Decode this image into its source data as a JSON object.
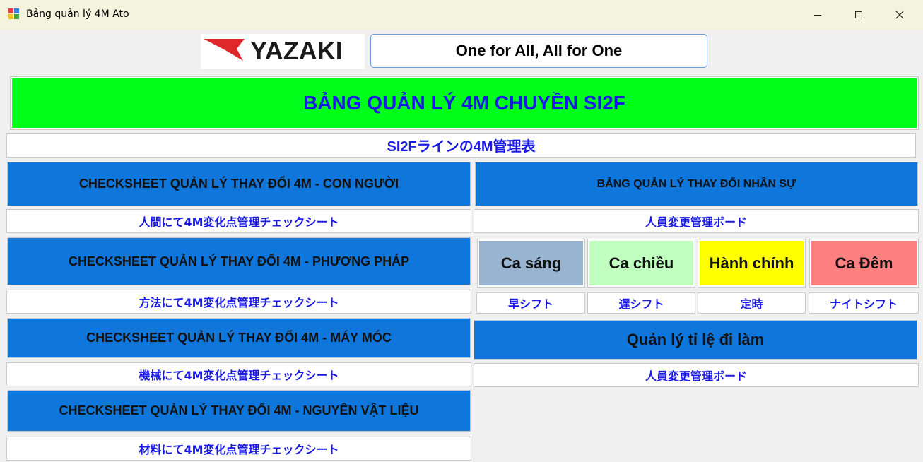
{
  "window": {
    "title": "Bảng quản lý 4M Ato"
  },
  "header": {
    "logo_text": "YAZAKI",
    "slogan": "One for All, All for One"
  },
  "banner": {
    "title": "BẢNG QUẢN LÝ 4M CHUYỀN SI2F",
    "subtitle": "SI2Fラインの4M管理表",
    "color": "#00ff1a"
  },
  "left": {
    "items": [
      {
        "label": "CHECKSHEET QUẢN LÝ THAY ĐỔI 4M - CON NGƯỜI",
        "jp": "人間にて4M変化点管理チェックシート"
      },
      {
        "label": "CHECKSHEET QUẢN LÝ THAY ĐỔI 4M - PHƯƠNG PHÁP",
        "jp": "方法にて4M変化点管理チェックシート"
      },
      {
        "label": "CHECKSHEET QUẢN LÝ THAY ĐỔI 4M - MÁY MÓC",
        "jp": "機械にて4M変化点管理チェックシート"
      },
      {
        "label": "CHECKSHEET QUẢN LÝ THAY ĐỔI 4M - NGUYÊN VẬT LIỆU",
        "jp": "材料にて4M変化点管理チェックシート"
      }
    ]
  },
  "right": {
    "personnel": {
      "label": "BẢNG QUẢN LÝ THAY ĐỔI NHÂN SỰ",
      "jp": "人員変更管理ボード"
    },
    "shifts": [
      {
        "label": "Ca sáng",
        "jp": "早シフト",
        "color": "#99b4d1"
      },
      {
        "label": "Ca chiều",
        "jp": "遅シフト",
        "color": "#c0ffc0"
      },
      {
        "label": "Hành chính",
        "jp": "定時",
        "color": "#ffff00"
      },
      {
        "label": "Ca Đêm",
        "jp": "ナイトシフト",
        "color": "#ff8080"
      }
    ],
    "attendance": {
      "label": "Quản lý tỉ lệ đi làm",
      "jp": "人員変更管理ボード"
    }
  },
  "colors": {
    "button_blue": "#0f76dc",
    "label_text": "#1a1ae6",
    "window_bg": "#f0f0f0"
  },
  "icons": {
    "app": "app-icon",
    "minimize": "minimize-icon",
    "maximize": "maximize-icon",
    "close": "close-icon"
  }
}
